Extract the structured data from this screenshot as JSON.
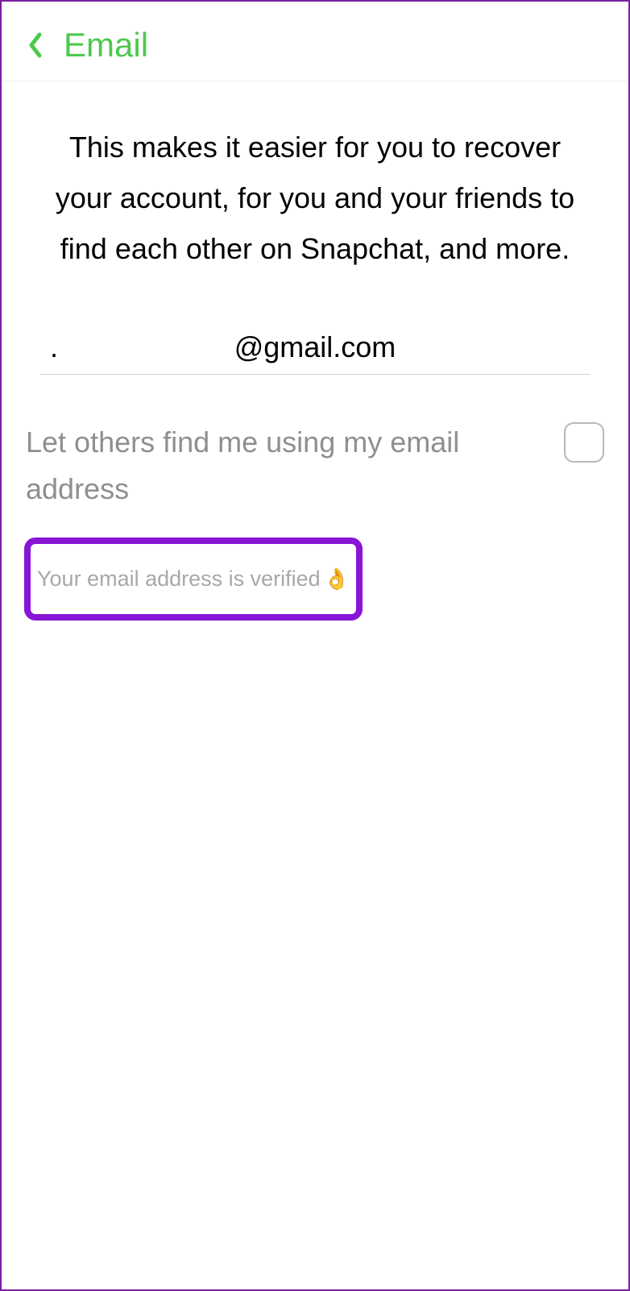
{
  "header": {
    "title": "Email"
  },
  "content": {
    "description": "This makes it easier for you to recover your account, for you and your friends to find each other on Snapchat, and more.",
    "email_value": "@gmail.com",
    "email_dot": ".",
    "toggle_label": "Let others find me using my email address",
    "verified_text": "Your email address is verified",
    "verified_emoji": "👌"
  }
}
